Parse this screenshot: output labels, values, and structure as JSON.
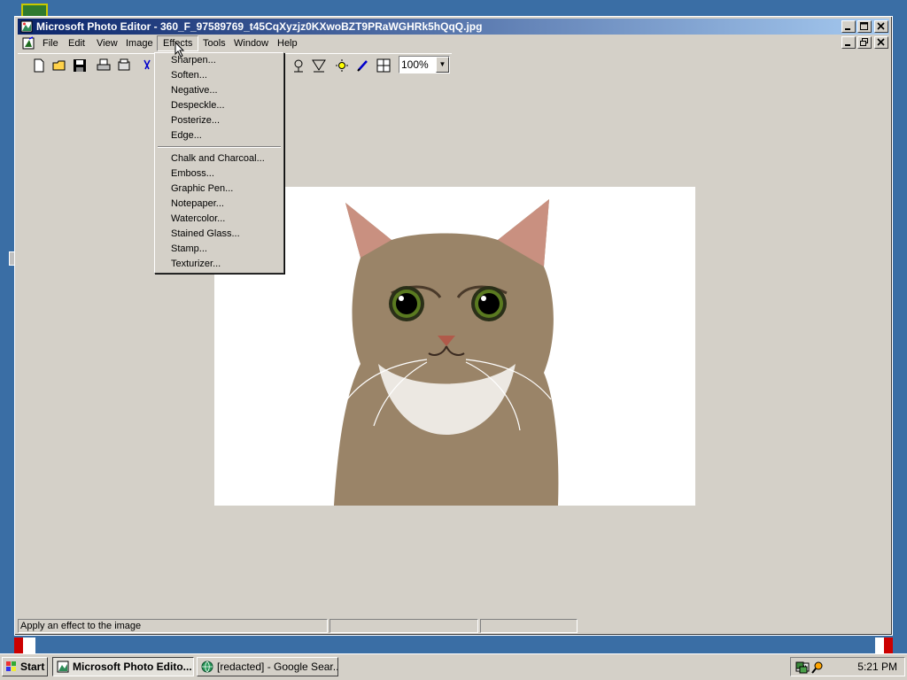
{
  "window": {
    "title": "Microsoft Photo Editor - 360_F_97589769_t45CqXyzjz0KXwoBZT9PRaWGHRk5hQqQ.jpg"
  },
  "menubar": {
    "items": [
      "File",
      "Edit",
      "View",
      "Image",
      "Effects",
      "Tools",
      "Window",
      "Help"
    ],
    "active": "Effects"
  },
  "toolbar": {
    "zoom_value": "100%"
  },
  "effects_menu": {
    "group1": [
      "Sharpen...",
      "Soften...",
      "Negative...",
      "Despeckle...",
      "Posterize...",
      "Edge..."
    ],
    "group2": [
      "Chalk and Charcoal...",
      "Emboss...",
      "Graphic Pen...",
      "Notepaper...",
      "Watercolor...",
      "Stained Glass...",
      "Stamp...",
      "Texturizer..."
    ]
  },
  "statusbar": {
    "message": "Apply an effect to the image"
  },
  "taskbar": {
    "start_label": "Start",
    "tasks": [
      "Microsoft Photo Edito...",
      "[redacted] - Google Sear..."
    ],
    "clock": "5:21 PM"
  },
  "colors": {
    "titlebar_start": "#0a246a",
    "titlebar_end": "#a6caf0",
    "face": "#d4d0c8"
  }
}
